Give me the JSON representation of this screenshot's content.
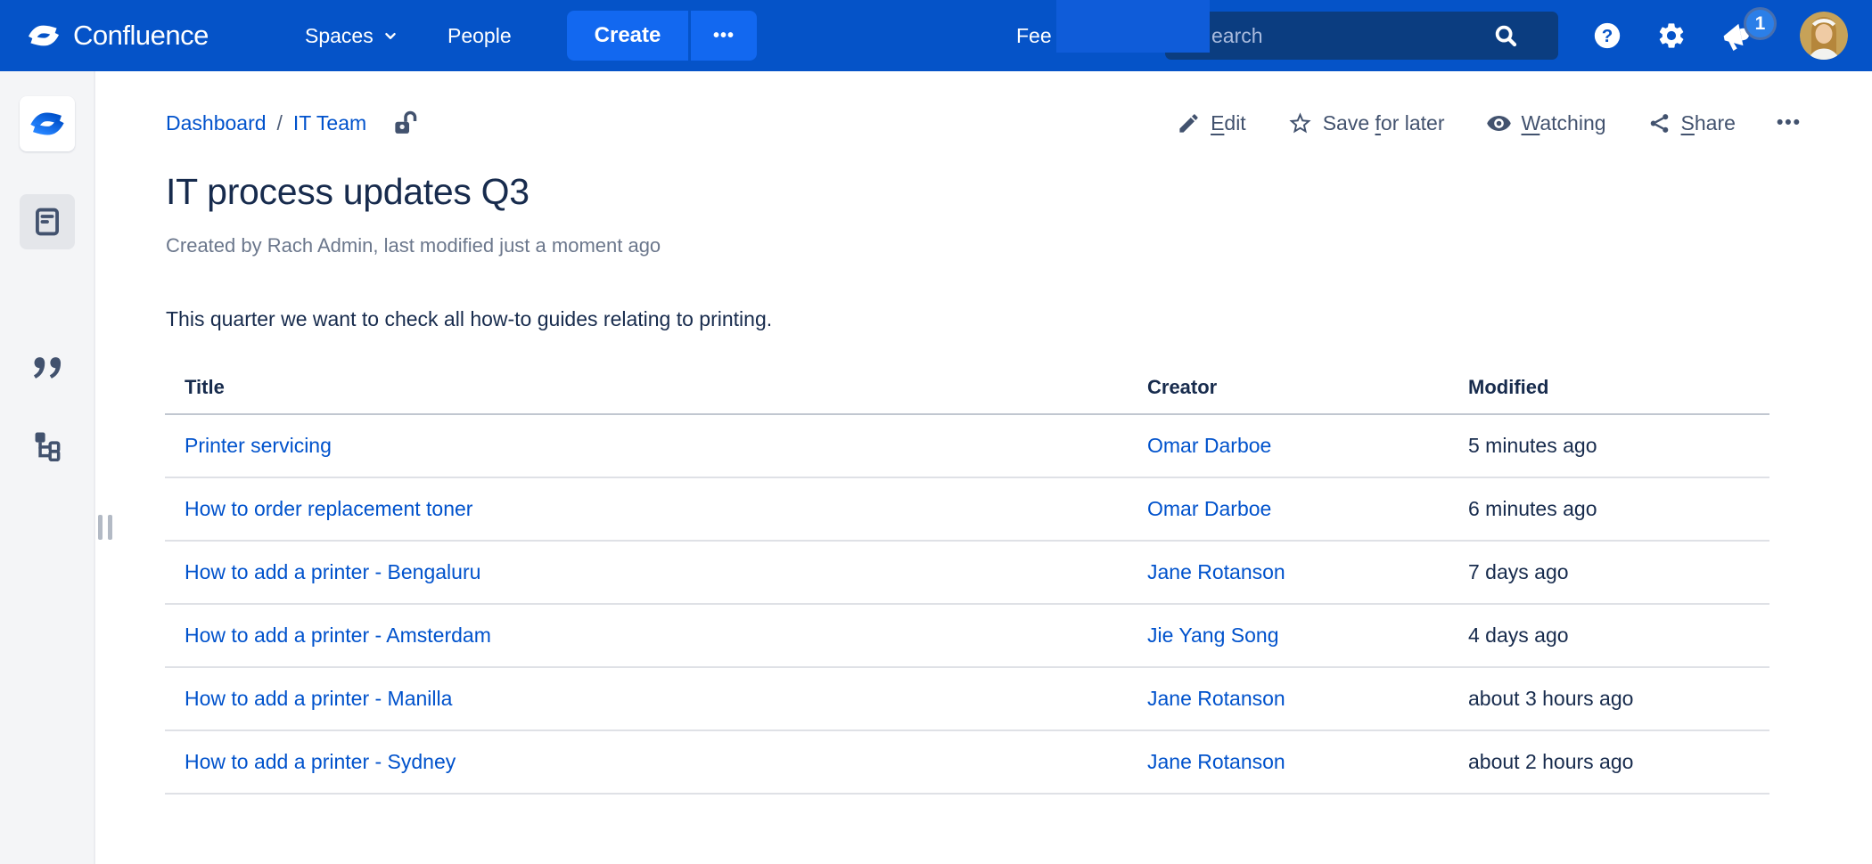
{
  "colors": {
    "navbar": "#0553C8",
    "create_button": "#1268F0",
    "search_box": "#0B3D80",
    "link": "#0052CC",
    "text_dark": "#172B4D",
    "text_slate": "#42526E",
    "text_muted": "#6B778C",
    "sidebar_bg": "#F4F5F7",
    "notification_badge": "#2B7FE8"
  },
  "topbar": {
    "brand": "Confluence",
    "spaces_label": "Spaces",
    "people_label": "People",
    "create_label": "Create",
    "create_more_label": "•••",
    "feed_label_clipped": "Fee",
    "search_placeholder_visible": "earch",
    "notification_count": "1"
  },
  "sidebar": {
    "icons": [
      "confluence-space-logo",
      "pages-icon",
      "blog-quote-icon",
      "page-tree-icon"
    ]
  },
  "page": {
    "breadcrumbs": {
      "items": [
        "Dashboard",
        "IT Team"
      ],
      "separator": "/"
    },
    "actions": {
      "edit": {
        "pre": "",
        "key": "E",
        "post": "dit"
      },
      "save": {
        "pre": "Save ",
        "key": "f",
        "post": "or later"
      },
      "watch": {
        "pre": "",
        "key": "W",
        "post": "atching"
      },
      "share": {
        "pre": "",
        "key": "S",
        "post": "hare"
      },
      "more": "•••"
    },
    "title": "IT process updates Q3",
    "byline": "Created by Rach Admin, last modified just a moment ago",
    "intro": "This quarter we want to check all how-to guides relating to printing.",
    "table": {
      "headers": {
        "title": "Title",
        "creator": "Creator",
        "modified": "Modified"
      },
      "rows": [
        {
          "title": "Printer servicing",
          "creator": "Omar Darboe",
          "modified": "5 minutes ago"
        },
        {
          "title": "How to order replacement toner",
          "creator": "Omar Darboe",
          "modified": "6 minutes ago"
        },
        {
          "title": "How to add a printer - Bengaluru",
          "creator": "Jane Rotanson",
          "modified": "7 days ago"
        },
        {
          "title": "How to add a printer - Amsterdam",
          "creator": "Jie Yang Song",
          "modified": "4 days ago"
        },
        {
          "title": "How to add a printer - Manilla",
          "creator": "Jane Rotanson",
          "modified": "about 3 hours ago"
        },
        {
          "title": "How to add a printer - Sydney",
          "creator": "Jane Rotanson",
          "modified": "about 2 hours ago"
        }
      ]
    }
  }
}
